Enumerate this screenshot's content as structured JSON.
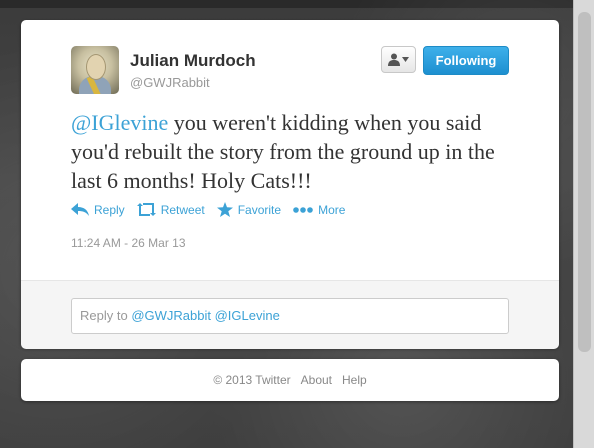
{
  "tweet": {
    "author_name": "Julian Murdoch",
    "author_handle": "@GWJRabbit",
    "follow_label": "Following",
    "text_mention": "@IGlevine",
    "text_body": " you weren't kidding when you said you'd rebuilt the story from the ground up in the last 6 months!  Holy Cats!!!",
    "timestamp": "11:24 AM - 26 Mar 13"
  },
  "actions": [
    {
      "label": "Reply",
      "icon": "reply-icon"
    },
    {
      "label": "Retweet",
      "icon": "retweet-icon"
    },
    {
      "label": "Favorite",
      "icon": "star-icon"
    },
    {
      "label": "More",
      "icon": "more-icon"
    }
  ],
  "reply": {
    "prefix": "Reply to ",
    "mentions": "@GWJRabbit @IGLevine"
  },
  "footer": {
    "copyright": "© 2013 Twitter",
    "about": "About",
    "help": "Help"
  },
  "colors": {
    "link": "#3ca2d6",
    "follow_button": "#2a9fe0"
  }
}
